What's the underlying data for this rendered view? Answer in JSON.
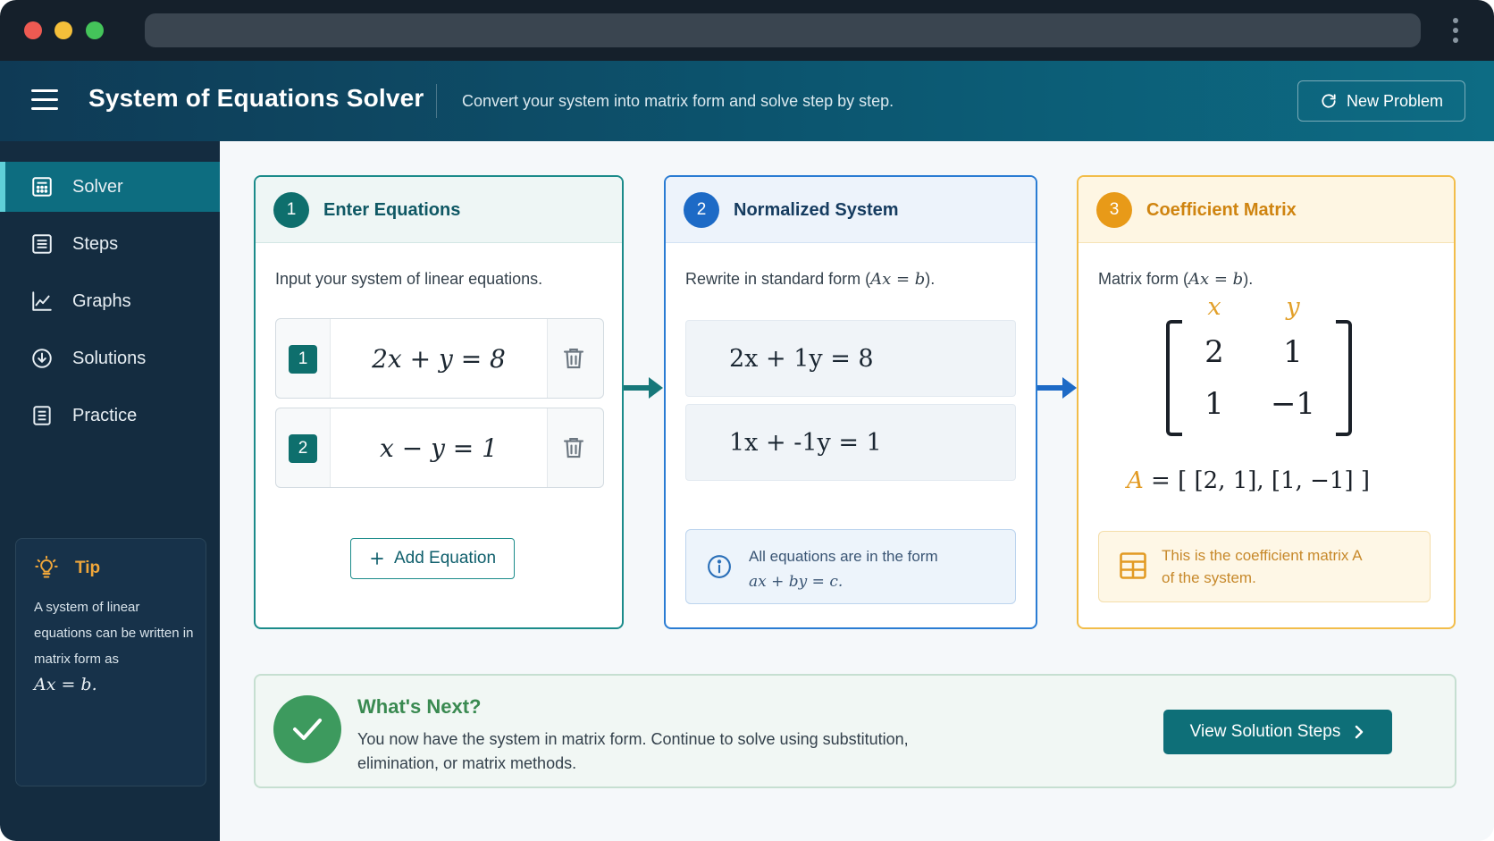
{
  "app": {
    "title": "System of Equations Solver",
    "subtitle": "Convert your system into matrix form and solve step by step.",
    "new_problem_label": "New Problem"
  },
  "sidebar": {
    "items": [
      {
        "label": "Solver",
        "icon": "calculator-icon",
        "active": true
      },
      {
        "label": "Steps",
        "icon": "list-icon",
        "active": false
      },
      {
        "label": "Graphs",
        "icon": "line-chart-icon",
        "active": false
      },
      {
        "label": "Solutions",
        "icon": "download-circle-icon",
        "active": false
      },
      {
        "label": "Practice",
        "icon": "document-icon",
        "active": false
      }
    ],
    "tip": {
      "title": "Tip",
      "body": "A system of linear equations can be written in matrix form as",
      "formula": "Ax = b."
    }
  },
  "step1": {
    "number": "1",
    "title": "Enter Equations",
    "description": "Input your system of linear equations.",
    "equations": [
      {
        "index": "1",
        "text": "2x + y = 8"
      },
      {
        "index": "2",
        "text": "x − y = 1"
      }
    ],
    "add_label": "Add Equation"
  },
  "step2": {
    "number": "2",
    "title": "Normalized System",
    "description_prefix": "Rewrite in standard form (",
    "description_math": "Ax = b",
    "description_suffix": ").",
    "rows": [
      "2x + 1y = 8",
      "1x + -1y = 1"
    ],
    "info_line1": "All equations are in the form",
    "info_line2": "ax + by = c."
  },
  "step3": {
    "number": "3",
    "title": "Coefficient Matrix",
    "description_prefix": "Matrix form (",
    "description_math": "Ax = b",
    "description_suffix": ").",
    "col_labels": [
      "x",
      "y"
    ],
    "matrix": [
      [
        "2",
        "1"
      ],
      [
        "1",
        "−1"
      ]
    ],
    "a_var": "A",
    "a_definition": "= [ [2, 1], [1, −1] ]",
    "note_line1": "This is the coefficient matrix A",
    "note_line2": "of the system."
  },
  "next": {
    "title": "What's Next?",
    "body": "You now have the system in matrix form. Continue to solve using substitution, elimination, or matrix methods.",
    "button_label": "View Solution Steps"
  },
  "colors": {
    "teal": "#0e6f6d",
    "blue": "#1d6ac6",
    "amber": "#e89a18",
    "green": "#3d9a5e"
  }
}
